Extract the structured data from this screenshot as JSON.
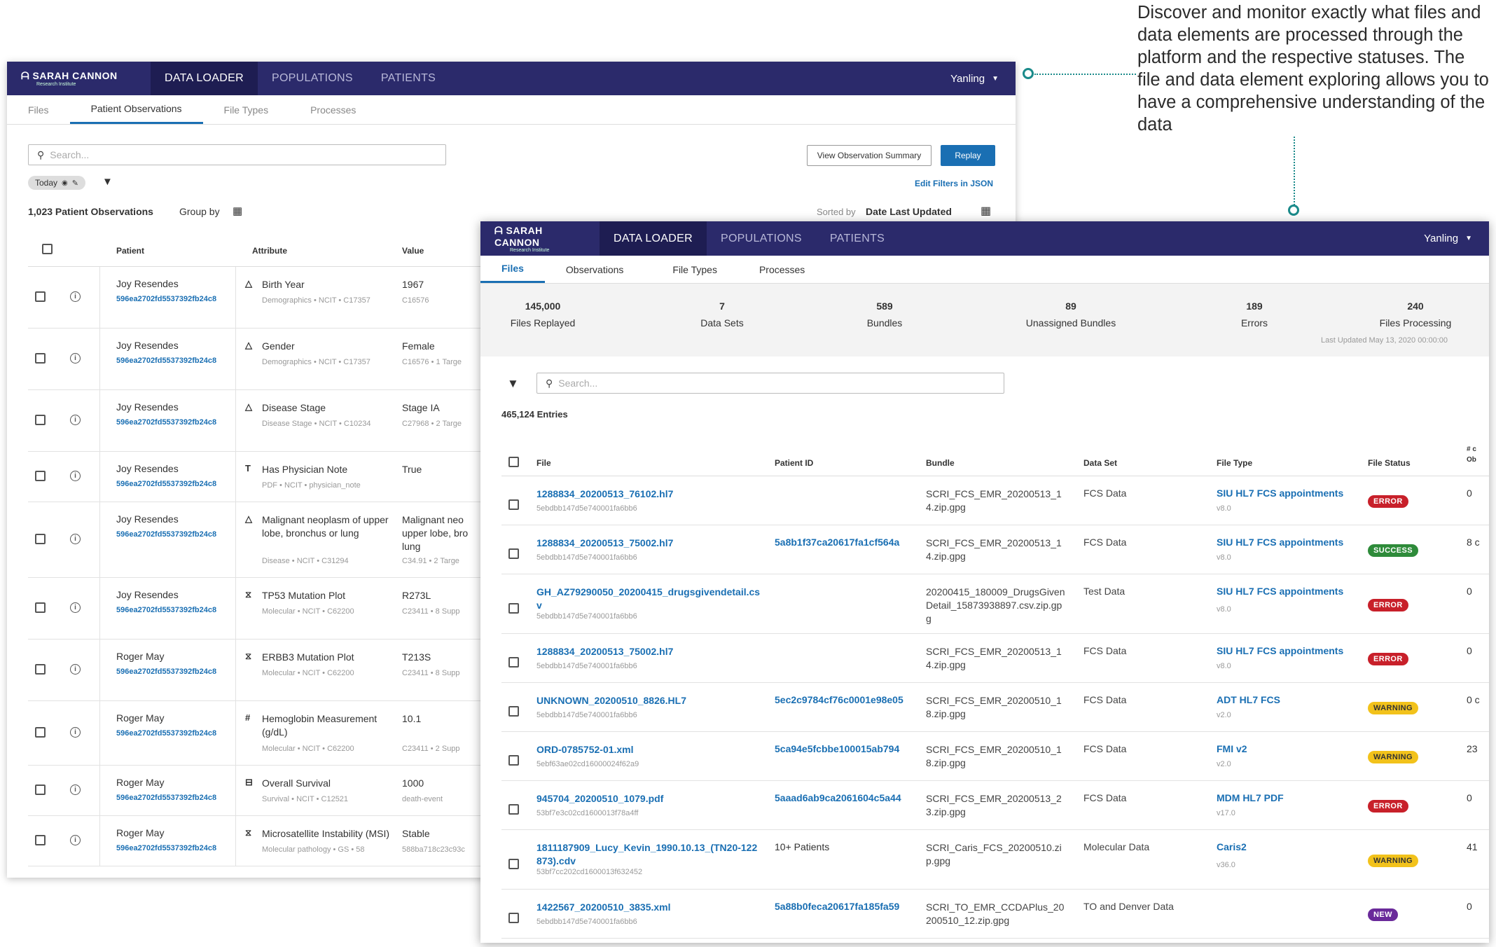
{
  "callout": {
    "text": "Discover and monitor exactly what files and data elements are processed through the platform and the respective statuses. The file and data element exploring allows you to have a comprehensive understanding of the data"
  },
  "brand": {
    "name": "SARAH CANNON",
    "tagline": "Research Institute"
  },
  "nav": {
    "items": [
      "DATA LOADER",
      "POPULATIONS",
      "PATIENTS"
    ],
    "user": "Yanling"
  },
  "back": {
    "tabs": [
      "Files",
      "Patient Observations",
      "File Types",
      "Processes"
    ],
    "search_placeholder": "Search...",
    "view_summary": "View Observation Summary",
    "replay": "Replay",
    "filter_chip": "Today",
    "edit_filters": "Edit Filters in JSON",
    "count": "1,023 Patient Observations",
    "group_by": "Group by",
    "sorted_by_label": "Sorted by",
    "sorted_by_value": "Date Last Updated",
    "columns": [
      "Patient",
      "Attribute",
      "Value"
    ],
    "rows": [
      {
        "patient": "Joy Resendes",
        "id": "596ea2702fd5537392fb24c8",
        "attr": "Birth Year",
        "attr_sub": "Demographics  •  NCIT  •  C17357",
        "value": "1967",
        "value_sub": "C16576",
        "icon": "△",
        "h": 88
      },
      {
        "patient": "Joy Resendes",
        "id": "596ea2702fd5537392fb24c8",
        "attr": "Gender",
        "attr_sub": "Demographics  •  NCIT  •  C17357",
        "value": "Female",
        "value_sub": "C16576  •  1 Targe",
        "icon": "△",
        "h": 88
      },
      {
        "patient": "Joy Resendes",
        "id": "596ea2702fd5537392fb24c8",
        "attr": "Disease Stage",
        "attr_sub": "Disease Stage  •  NCIT  •  C10234",
        "value": "Stage IA",
        "value_sub": "C27968  •  2 Targe",
        "icon": "△",
        "h": 88
      },
      {
        "patient": "Joy Resendes",
        "id": "596ea2702fd5537392fb24c8",
        "attr": "Has Physician Note",
        "attr_sub": "PDF  •  NCIT  •  physician_note",
        "value": "True",
        "value_sub": "",
        "icon": "T",
        "h": 72
      },
      {
        "patient": "Joy Resendes",
        "id": "596ea2702fd5537392fb24c8",
        "attr": "Malignant neoplasm of upper lobe, bronchus or lung",
        "attr_sub": "Disease  •  NCIT  •  C31294",
        "value": "Malignant neo upper lobe, bro lung",
        "value_sub": "C34.91  •  2 Targe",
        "icon": "△",
        "h": 108
      },
      {
        "patient": "Joy Resendes",
        "id": "596ea2702fd5537392fb24c8",
        "attr": "TP53 Mutation Plot",
        "attr_sub": "Molecular  •  NCIT  •  C62200",
        "value": "R273L",
        "value_sub": "C23411  •  8 Supp",
        "icon": "⧖",
        "h": 88
      },
      {
        "patient": "Roger May",
        "id": "596ea2702fd5537392fb24c8",
        "attr": "ERBB3 Mutation Plot",
        "attr_sub": "Molecular  •  NCIT  •  C62200",
        "value": "T213S",
        "value_sub": "C23411  •  8 Supp",
        "icon": "⧖",
        "h": 88
      },
      {
        "patient": "Roger May",
        "id": "596ea2702fd5537392fb24c8",
        "attr": "Hemoglobin Measurement (g/dL)",
        "attr_sub": "Molecular  •  NCIT  •  C62200",
        "value": "10.1",
        "value_sub": "C23411  •  2 Supp",
        "icon": "#",
        "h": 92
      },
      {
        "patient": "Roger May",
        "id": "596ea2702fd5537392fb24c8",
        "attr": "Overall Survival",
        "attr_sub": "Survival  •  NCIT  •  C12521",
        "value": "1000",
        "value_sub": "death-event",
        "icon": "⊟",
        "h": 72
      },
      {
        "patient": "Roger May",
        "id": "596ea2702fd5537392fb24c8",
        "attr": "Microsatellite Instability (MSI)",
        "attr_sub": "Molecular pathology  •  GS  •  58",
        "value": "Stable",
        "value_sub": "588ba718c23c93c",
        "icon": "⧖",
        "h": 72
      }
    ]
  },
  "front": {
    "tabs": [
      "Files",
      "Observations",
      "File Types",
      "Processes"
    ],
    "stats": [
      {
        "value": "145,000",
        "label": "Files Replayed"
      },
      {
        "value": "7",
        "label": "Data Sets"
      },
      {
        "value": "589",
        "label": "Bundles"
      },
      {
        "value": "89",
        "label": "Unassigned Bundles"
      },
      {
        "value": "189",
        "label": "Errors"
      },
      {
        "value": "240",
        "label": "Files Processing"
      }
    ],
    "last_updated": "Last Updated May 13, 2020 00:00:00",
    "search_placeholder": "Search...",
    "entries": "465,124 Entries",
    "columns": [
      "File",
      "Patient ID",
      "Bundle",
      "Data Set",
      "File Type",
      "File Status",
      "# c Ob"
    ],
    "rows": [
      {
        "file": "1288834_20200513_76102.hl7",
        "file_sub": "5ebdbb147d5e740001fa6bb6",
        "pid": "",
        "bundle": "SCRI_FCS_EMR_20200513_14.zip.gpg",
        "dataset": "FCS Data",
        "type": "SIU HL7 FCS appointments",
        "type_sub": "v8.0",
        "status": "ERROR",
        "count": "0",
        "h": 70
      },
      {
        "file": "1288834_20200513_75002.hl7",
        "file_sub": "5ebdbb147d5e740001fa6bb6",
        "pid": "5a8b1f37ca20617fa1cf564a",
        "bundle": "SCRI_FCS_EMR_20200513_14.zip.gpg",
        "dataset": "FCS Data",
        "type": "SIU HL7 FCS appointments",
        "type_sub": "v8.0",
        "status": "SUCCESS",
        "count": "8 c",
        "h": 70
      },
      {
        "file": "GH_AZ79290050_20200415_drugsgivendetail.csv",
        "file_sub": "5ebdbb147d5e740001fa6bb6",
        "pid": "",
        "bundle": "20200415_180009_DrugsGivenDetail_15873938897.csv.zip.gpg",
        "dataset": "Test Data",
        "type": "SIU HL7 FCS appointments",
        "type_sub": "v8.0",
        "status": "ERROR",
        "count": "0",
        "h": 85
      },
      {
        "file": "1288834_20200513_75002.hl7",
        "file_sub": "5ebdbb147d5e740001fa6bb6",
        "pid": "",
        "bundle": "SCRI_FCS_EMR_20200513_14.zip.gpg",
        "dataset": "FCS Data",
        "type": "SIU HL7 FCS appointments",
        "type_sub": "v8.0",
        "status": "ERROR",
        "count": "0",
        "h": 70
      },
      {
        "file": "UNKNOWN_20200510_8826.HL7",
        "file_sub": "5ebdbb147d5e740001fa6bb6",
        "pid": "5ec2c9784cf76c0001e98e05",
        "bundle": "SCRI_FCS_EMR_20200510_18.zip.gpg",
        "dataset": "FCS Data",
        "type": "ADT HL7 FCS",
        "type_sub": "v2.0",
        "status": "WARNING",
        "count": "0 c",
        "h": 70
      },
      {
        "file": "ORD-0785752-01.xml",
        "file_sub": "5ebf63ae02cd16000024f62a9",
        "pid": "5ca94e5fcbbe100015ab794",
        "bundle": "SCRI_FCS_EMR_20200510_18.zip.gpg",
        "dataset": "FCS Data",
        "type": "FMI v2",
        "type_sub": "v2.0",
        "status": "WARNING",
        "count": "23",
        "h": 70
      },
      {
        "file": "945704_20200510_1079.pdf",
        "file_sub": "53bf7e3c02cd1600013f78a4ff",
        "pid": "5aaad6ab9ca2061604c5a44",
        "bundle": "SCRI_FCS_EMR_20200513_23.zip.gpg",
        "dataset": "FCS Data",
        "type": "MDM HL7 PDF",
        "type_sub": "v17.0",
        "status": "ERROR",
        "count": "0",
        "h": 70
      },
      {
        "file": "1811187909_Lucy_Kevin_1990.10.13_(TN20-122873).cdv",
        "file_sub": "53bf7cc202cd1600013f632452",
        "pid": "10+ Patients",
        "bundle": "SCRI_Caris_FCS_20200510.zip.gpg",
        "dataset": "Molecular Data",
        "type": "Caris2",
        "type_sub": "v36.0",
        "status": "WARNING",
        "count": "41",
        "h": 85
      },
      {
        "file": "1422567_20200510_3835.xml",
        "file_sub": "5ebdbb147d5e740001fa6bb6",
        "pid": "5a88b0feca20617fa185fa59",
        "bundle": "SCRI_TO_EMR_CCDAPlus_20200510_12.zip.gpg",
        "dataset": "TO and Denver Data",
        "type": "",
        "type_sub": "",
        "status": "NEW",
        "count": "0",
        "h": 70
      }
    ]
  },
  "colors": {
    "nav": "#2b2a6b",
    "link": "#1a6fb3",
    "error": "#c8202a",
    "success": "#2e8b3a",
    "warning": "#f2c21b",
    "new": "#6a2a9a"
  }
}
